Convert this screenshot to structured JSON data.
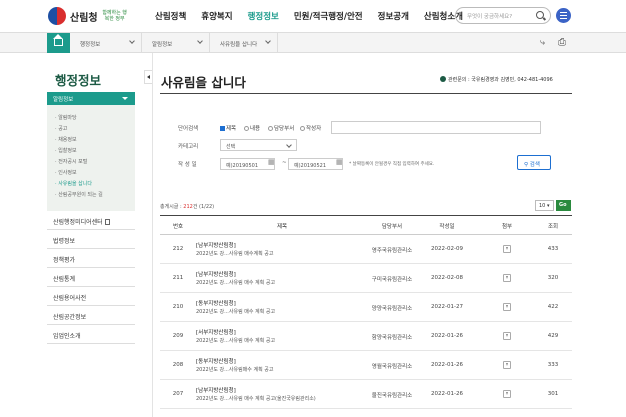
{
  "header": {
    "logo_text": "산림청",
    "logo_slogan": "함께하는 행복한 정부",
    "nav": [
      "산림정책",
      "휴양복지",
      "행정정보",
      "민원/적극행정/안전",
      "정보공개",
      "산림청소개"
    ],
    "active_nav_index": 2,
    "search_placeholder": "무엇이 궁금하세요?"
  },
  "breadcrumb": [
    "행정정보",
    "알림정보",
    "사유림을 삽니다"
  ],
  "sidebar": {
    "title": "행정정보",
    "active_section": "알림정보",
    "sub_items": [
      "알림마당",
      "공고",
      "채용정보",
      "입찰정보",
      "전자공시 포털",
      "인사정보",
      "사유림을 삽니다",
      "산림공무원이 되는 길"
    ],
    "current_sub_index": 6,
    "items": [
      "산림행정미디어센터",
      "법령정보",
      "정책평가",
      "산림통계",
      "산림용어사전",
      "산림공간정보",
      "임업인소개"
    ]
  },
  "main": {
    "title": "사유림을 삽니다",
    "contact": "관련문의 : 국유림경영과 김영민, 042-481-4096",
    "search": {
      "keyword_label": "단어검색",
      "options": [
        "제목",
        "내용",
        "담당부서",
        "작성자"
      ],
      "category_label": "카테고리",
      "category_value": "선택",
      "date_label": "작 성 일",
      "date_from": "예)20190501",
      "date_sep": "~",
      "date_to": "예)20190521",
      "date_hint": "* 날짜등록이 안될경우 직접 입력하여 주세요.",
      "search_button": "검색"
    },
    "total_prefix": "총게시글 : ",
    "total_count": "212",
    "total_suffix": "건 (1/22)",
    "page_size": "10",
    "go_label": "Go",
    "columns": [
      "번호",
      "제목",
      "담당부서",
      "작성일",
      "첨부",
      "조회"
    ],
    "rows": [
      {
        "no": "212",
        "tag": "[남부지방산림청]",
        "title": "2022년도 강...사유림 매수계획 공고",
        "dept": "영주국유림관리소",
        "date": "2022-02-09",
        "views": "433"
      },
      {
        "no": "211",
        "tag": "[남부지방산림청]",
        "title": "2022년도 강...사유림 매수 계획 공고",
        "dept": "구미국유림관리소",
        "date": "2022-02-08",
        "views": "320"
      },
      {
        "no": "210",
        "tag": "[동부지방산림청]",
        "title": "2022년도 강...사유림 매수 계획 공고",
        "dept": "양양국유림관리소",
        "date": "2022-01-27",
        "views": "422"
      },
      {
        "no": "209",
        "tag": "[서부지방산림청]",
        "title": "2022년도 강...사유림 매수 계획 공고",
        "dept": "함양국유림관리소",
        "date": "2022-01-26",
        "views": "429"
      },
      {
        "no": "208",
        "tag": "[동부지방산림청]",
        "title": "2022년도 강...사유림매수 계획 공고",
        "dept": "영월국유림관리소",
        "date": "2022-01-26",
        "views": "333"
      },
      {
        "no": "207",
        "tag": "[남부지방산림청]",
        "title": "2022년도 강...사유림 매수 계획 공고(울진국유림관리소)",
        "dept": "울진국유림관리소",
        "date": "2022-01-26",
        "views": "301"
      }
    ]
  }
}
